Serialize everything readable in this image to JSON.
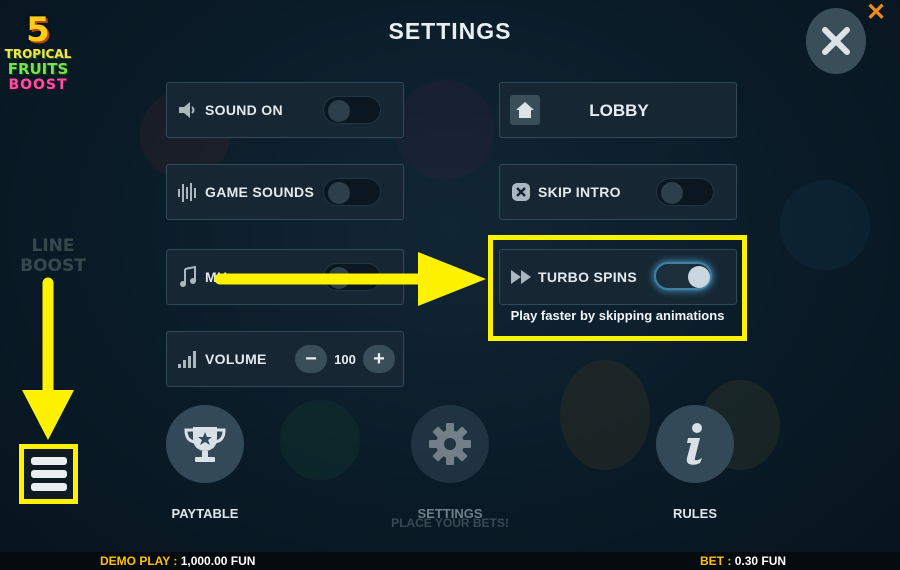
{
  "logo": {
    "number": "5",
    "line1": "TROPICAL",
    "line2": "FRUITS",
    "line3": "BOOST"
  },
  "background": {
    "side_text_1": "LINE",
    "side_text_2": "BOOST",
    "caption": "PLACE YOUR BETS!"
  },
  "header": {
    "title": "SETTINGS"
  },
  "close_button": {
    "icon": "close-icon"
  },
  "settings": {
    "sound_on": {
      "label": "SOUND ON",
      "enabled": false,
      "icon": "speaker-icon"
    },
    "game_sounds": {
      "label": "GAME SOUNDS",
      "enabled": false,
      "icon": "equalizer-icon"
    },
    "music": {
      "label": "MU",
      "enabled": false,
      "icon": "music-note-icon"
    },
    "volume": {
      "label": "VOLUME",
      "value": "100",
      "decrease": "−",
      "increase": "+",
      "icon": "volume-bars-icon"
    },
    "lobby": {
      "label": "LOBBY",
      "icon": "home-icon"
    },
    "skip_intro": {
      "label": "SKIP INTRO",
      "enabled": false,
      "icon": "skip-x-icon"
    },
    "turbo_spins": {
      "label": "TURBO SPINS",
      "enabled": true,
      "icon": "fast-forward-icon",
      "description": "Play faster by skipping animations"
    }
  },
  "bottom_nav": {
    "paytable": {
      "label": "PAYTABLE",
      "icon": "trophy-icon"
    },
    "settings": {
      "label": "SETTINGS",
      "icon": "gear-icon"
    },
    "rules": {
      "label": "RULES",
      "icon": "info-icon"
    }
  },
  "status_bar": {
    "demo_label": "DEMO PLAY :",
    "demo_value": "1,000.00 FUN",
    "bet_label": "BET :",
    "bet_value": "0.30 FUN"
  },
  "colors": {
    "highlight": "#fff200",
    "accent_orange": "#f08a1c",
    "status_yellow": "#ffc107",
    "toggle_glow": "#4aa7d8"
  }
}
